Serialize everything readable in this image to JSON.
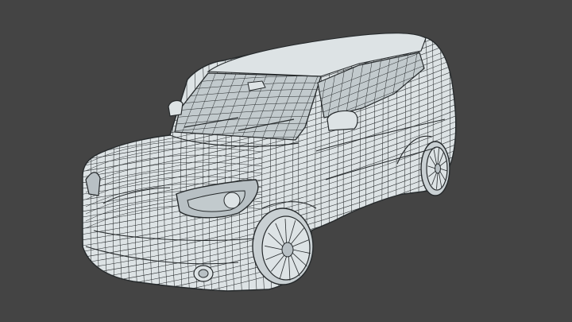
{
  "scene": {
    "background_color": "#444444",
    "body_fill": "#dde3e5",
    "body_shade": "#c9d0d3",
    "glass_fill": "#c2cacd",
    "dark_fill": "#b8c0c4",
    "wire_color": "#262a2c",
    "subject": "wireframe-car-model",
    "view": "front-three-quarter"
  }
}
